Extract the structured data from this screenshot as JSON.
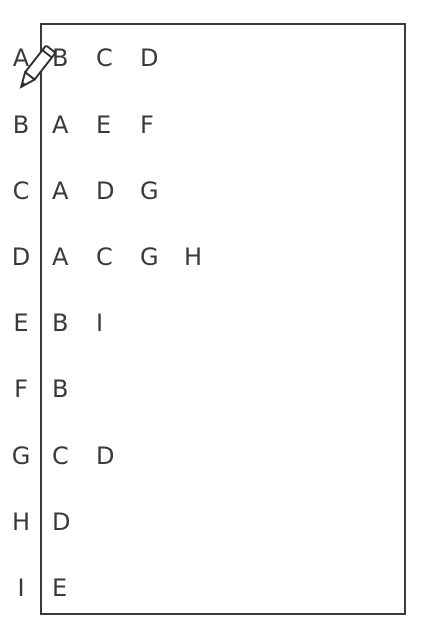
{
  "adjacency_list": [
    {
      "key": "A",
      "neighbors": [
        "B",
        "C",
        "D"
      ]
    },
    {
      "key": "B",
      "neighbors": [
        "A",
        "E",
        "F"
      ]
    },
    {
      "key": "C",
      "neighbors": [
        "A",
        "D",
        "G"
      ]
    },
    {
      "key": "D",
      "neighbors": [
        "A",
        "C",
        "G",
        "H"
      ]
    },
    {
      "key": "E",
      "neighbors": [
        "B",
        "I"
      ]
    },
    {
      "key": "F",
      "neighbors": [
        "B"
      ]
    },
    {
      "key": "G",
      "neighbors": [
        "C",
        "D"
      ]
    },
    {
      "key": "H",
      "neighbors": [
        "D"
      ]
    },
    {
      "key": "I",
      "neighbors": [
        "E"
      ]
    }
  ],
  "cursor_icon": "pencil-icon"
}
